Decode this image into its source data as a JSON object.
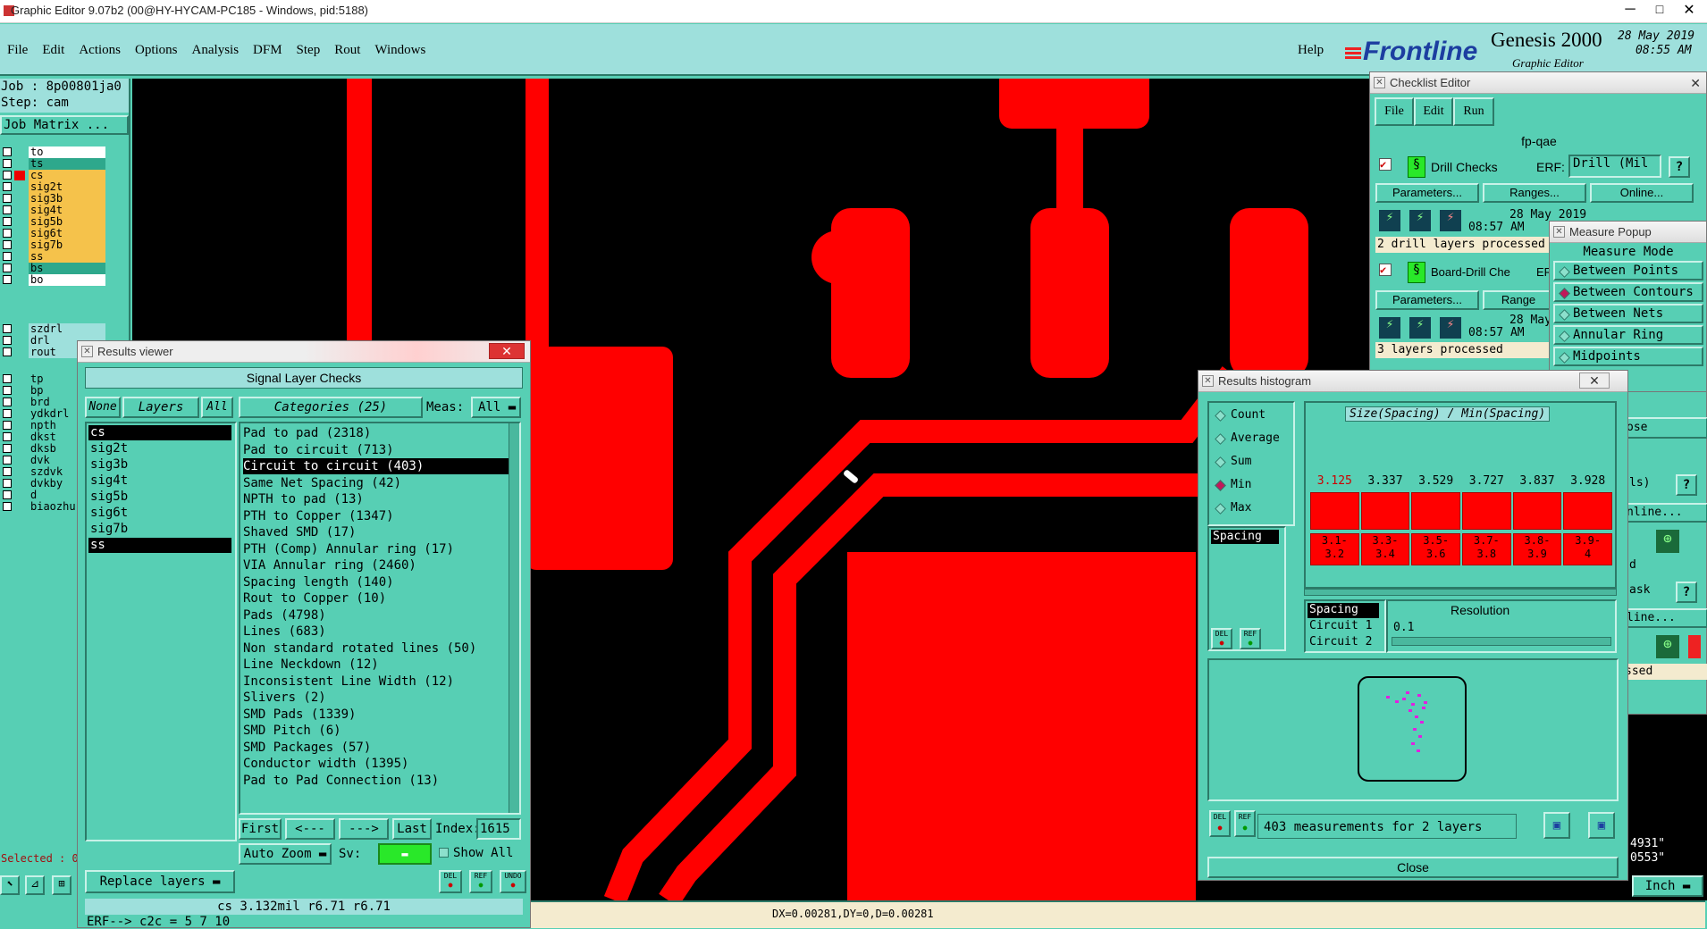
{
  "titlebar": {
    "title": "Graphic Editor 9.07b2 (00@HY-HYCAM-PC185 - Windows, pid:5188)"
  },
  "menu": {
    "items": [
      "File",
      "Edit",
      "Actions",
      "Options",
      "Analysis",
      "DFM",
      "Step",
      "Rout",
      "Windows"
    ],
    "help": "Help"
  },
  "brand": {
    "logo": "Frontline",
    "product": "Genesis 2000",
    "subtitle": "Graphic Editor",
    "date": "28 May 2019",
    "time": "08:55 AM"
  },
  "job": {
    "job": "Job : 8p00801ja0",
    "step": "Step: cam",
    "matrix": "Job Matrix ..."
  },
  "layers": [
    {
      "name": "to",
      "color": "#ffffff"
    },
    {
      "name": "ts",
      "color": "#2ea88c"
    },
    {
      "name": "cs",
      "color": "#f5c24b"
    },
    {
      "name": "sig2t",
      "color": "#f5c24b"
    },
    {
      "name": "sig3b",
      "color": "#f5c24b"
    },
    {
      "name": "sig4t",
      "color": "#f5c24b"
    },
    {
      "name": "sig5b",
      "color": "#f5c24b"
    },
    {
      "name": "sig6t",
      "color": "#f5c24b"
    },
    {
      "name": "sig7b",
      "color": "#f5c24b"
    },
    {
      "name": "ss",
      "color": "#f5c24b"
    },
    {
      "name": "bs",
      "color": "#2ea88c"
    },
    {
      "name": "bo",
      "color": "#ffffff"
    }
  ],
  "layers2": [
    "szdrl",
    "drl",
    "rout"
  ],
  "layers3": [
    "tp",
    "bp",
    "brd",
    "ydkdrl",
    "npth",
    "dkst",
    "dksb",
    "dvk",
    "szdvk",
    "dvkby",
    "d",
    "biaozhu"
  ],
  "selected_label": "Selected : 0",
  "results_viewer": {
    "title": "Results viewer",
    "header": "Signal Layer Checks",
    "none": "None",
    "layers": "Layers",
    "all": "All",
    "categories_label": "Categories (25)",
    "meas_label": "Meas:",
    "meas_value": "All",
    "layer_list": [
      "cs",
      "sig2t",
      "sig3b",
      "sig4t",
      "sig5b",
      "sig6t",
      "sig7b",
      "ss"
    ],
    "categories": [
      "Pad to pad (2318)",
      "Pad to circuit (713)",
      "Circuit to circuit (403)",
      "Same Net Spacing (42)",
      "NPTH to pad (13)",
      "PTH to Copper (1347)",
      "Shaved SMD (17)",
      "PTH (Comp) Annular ring (17)",
      "VIA Annular ring (2460)",
      "Spacing length (140)",
      "Rout to Copper (10)",
      "Pads (4798)",
      "Lines (683)",
      "Non standard rotated lines (50)",
      "Line Neckdown (12)",
      "Inconsistent Line Width (12)",
      "Slivers (2)",
      "SMD Pads (1339)",
      "SMD Pitch (6)",
      "SMD Packages (57)",
      "Conductor width (1395)",
      "Pad to Pad Connection (13)"
    ],
    "first": "First",
    "prev": "<---",
    "next": "--->",
    "last": "Last",
    "index_label": "Index:",
    "index_value": "1615",
    "auto_zoom": "Auto Zoom",
    "sv": "Sv:",
    "show_all": "Show All",
    "replace_layers": "Replace layers",
    "del": "DEL",
    "ref": "REF",
    "undo": "UNDO",
    "status": "cs 3.132mil   r6.71   r6.71",
    "erf": "ERF--> c2c = 5 7 10"
  },
  "coords": "DX=0.00281,DY=0,D=0.00281",
  "checklist": {
    "title": "Checklist Editor",
    "menu": [
      "File",
      "Edit",
      "Run"
    ],
    "name": "fp-qae",
    "drill_checks": "Drill Checks",
    "erf_label": "ERF:",
    "erf_value": "Drill (Mil",
    "parameters": "Parameters...",
    "ranges": "Ranges...",
    "online": "Online...",
    "date1": "28 May 2019",
    "time1": "08:57 AM",
    "status1": "2 drill layers processed",
    "board_drill": "Board-Drill Che",
    "erf2": "ER",
    "ranges2": "Range",
    "date2": "28 May",
    "time2": "08:57 AM",
    "status2": "3 layers processed",
    "frag_close": "ose",
    "frag_ls": "ls)",
    "frag_online": "nline...",
    "frag_d": "d",
    "frag_ask": "ask",
    "frag_online2": "line...",
    "frag_ssed": "ssed"
  },
  "measure": {
    "title": "Measure Popup",
    "header": "Measure Mode",
    "modes": [
      "Between Points",
      "Between Contours",
      "Between Nets",
      "Annular Ring",
      "Midpoints"
    ],
    "selected": 1
  },
  "histogram": {
    "title": "Results histogram",
    "stats": [
      "Count",
      "Average",
      "Sum",
      "Min",
      "Max"
    ],
    "selected_stat": 3,
    "chart_title": "Size(Spacing) / Min(Spacing)",
    "bin_values": [
      "3.125",
      "3.337",
      "3.529",
      "3.727",
      "3.837",
      "3.928"
    ],
    "bin_labels_top": [
      "3.1-",
      "3.3-",
      "3.5-",
      "3.7-",
      "3.8-",
      "3.9-"
    ],
    "bin_labels_bottom": [
      "3.2",
      "3.4",
      "3.6",
      "3.8",
      "3.9",
      "4"
    ],
    "list_left": "Spacing",
    "list_right": [
      "Spacing",
      "Circuit 1",
      "Circuit 2"
    ],
    "resolution_label": "Resolution",
    "resolution_value": "0.1",
    "summary": "403 measurements for 2 layers",
    "close": "Close",
    "del": "DEL",
    "ref": "REF"
  },
  "bottom_right": {
    "v1": "4931\"",
    "v2": "0553\"",
    "unit": "Inch"
  }
}
